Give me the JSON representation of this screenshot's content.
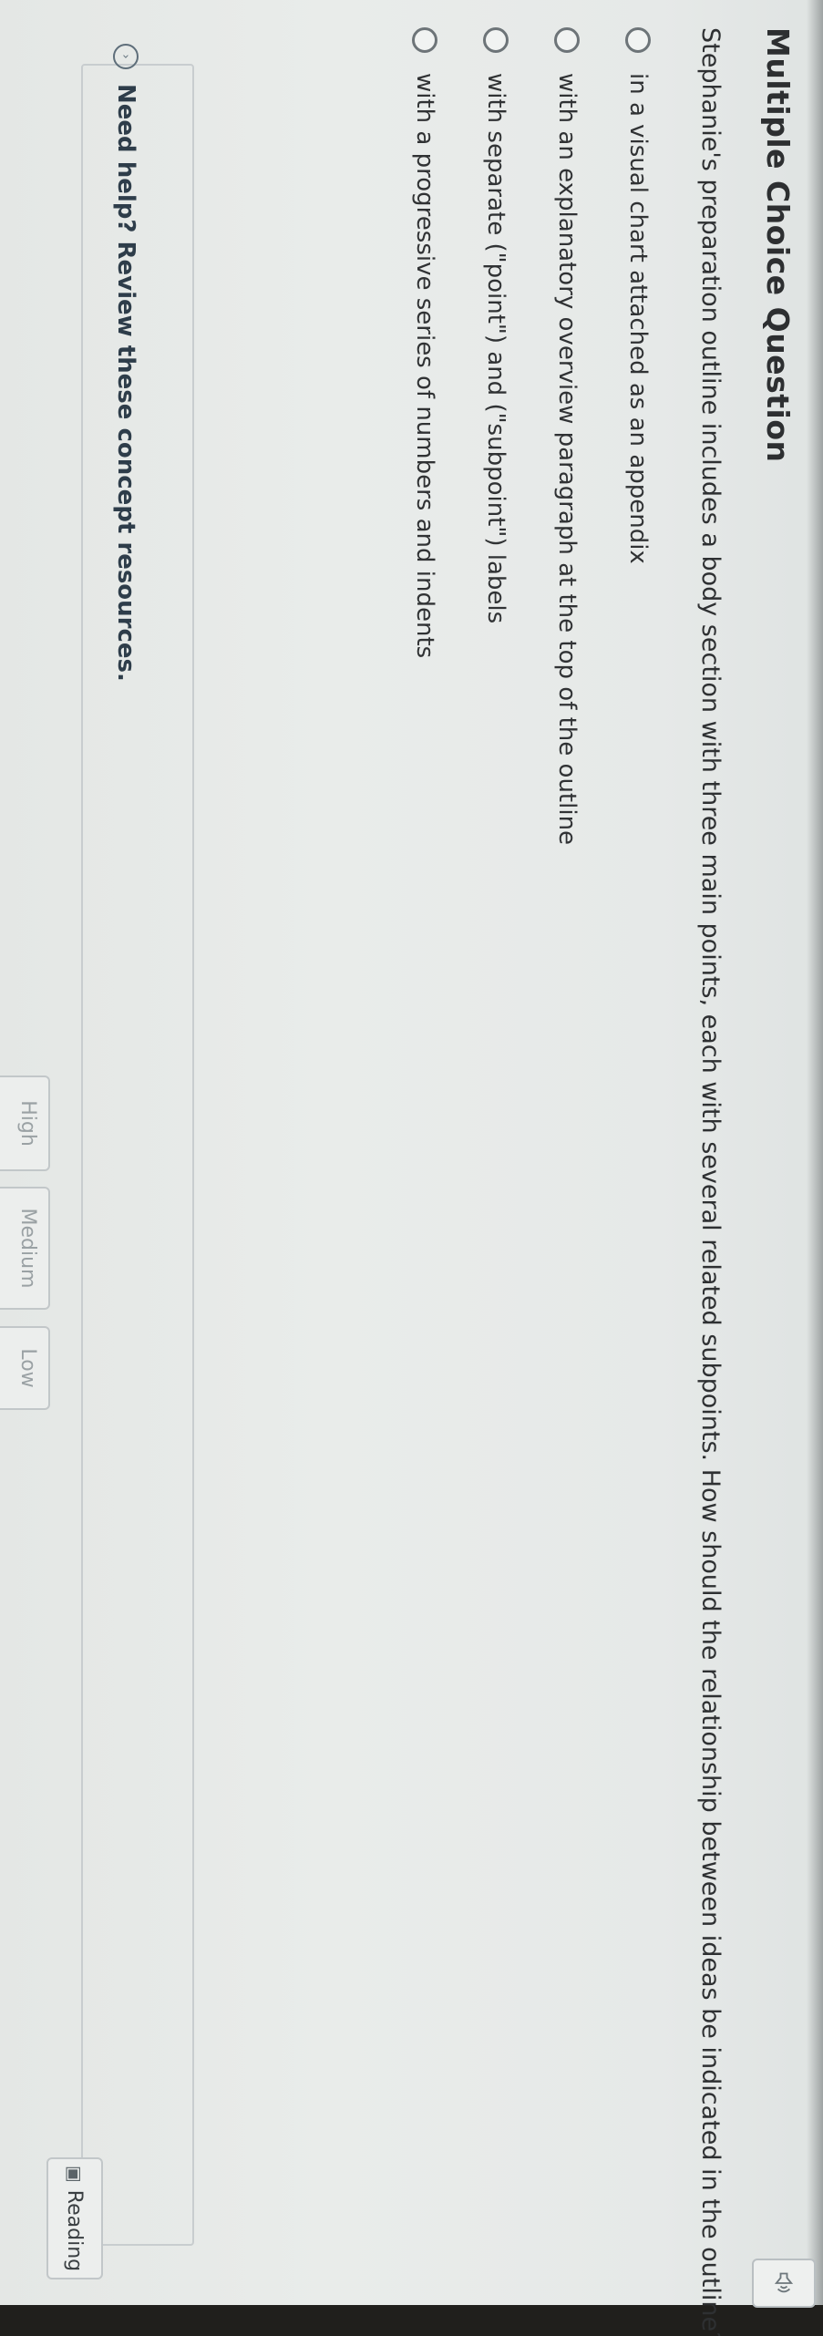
{
  "question": {
    "title": "Multiple Choice Question",
    "text": "Stephanie's preparation outline includes a body section with three main points, each with several related subpoints. How should the relationship between ideas be indicated in the outline?",
    "speaker_icon": "speaker-icon"
  },
  "options": [
    {
      "label": "in a visual chart attached as an appendix",
      "selected": false
    },
    {
      "label": "with an explanatory overview paragraph at the top of the outline",
      "selected": false
    },
    {
      "label": "with separate (\"point\") and (\"subpoint\") labels",
      "selected": false
    },
    {
      "label": "with a progressive series of numbers and indents",
      "selected": false
    }
  ],
  "help": {
    "text": "Need help? Review these concept resources.",
    "icon": "chevron-down-icon"
  },
  "confidence": {
    "tabs": [
      "High",
      "Medium",
      "Low"
    ]
  },
  "reading": {
    "label": "Reading",
    "icon": "book-icon"
  }
}
